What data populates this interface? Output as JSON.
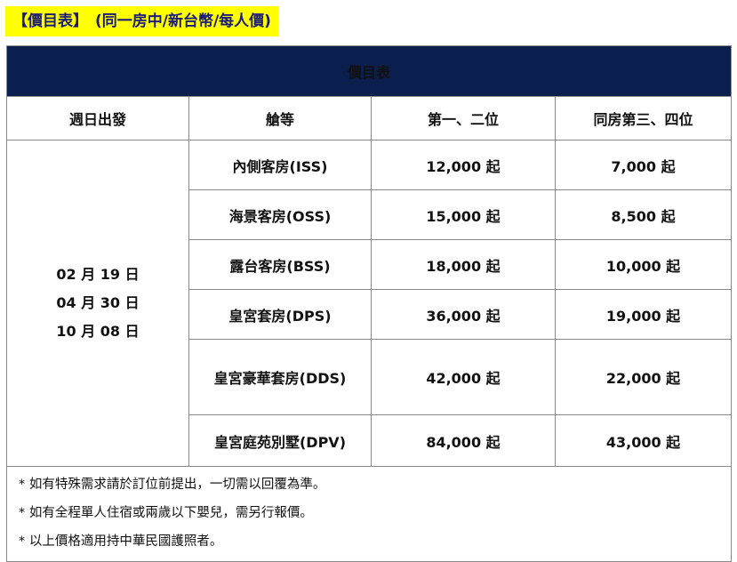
{
  "heading": {
    "title": "【價目表】",
    "subtitle": "(同一房中/新台幣/每人價)"
  },
  "table": {
    "title": "價目表",
    "columns": [
      "週日出發",
      "艙等",
      "第一、二位",
      "同房第三、四位"
    ],
    "departure_dates": [
      "02 月 19 日",
      "04 月 30 日",
      "10 月 08 日"
    ],
    "rows": [
      {
        "cabin": "內側客房(ISS)",
        "price_1_2": "12,000 起",
        "price_3_4": "7,000 起"
      },
      {
        "cabin": "海景客房(OSS)",
        "price_1_2": "15,000 起",
        "price_3_4": "8,500 起"
      },
      {
        "cabin": "露台客房(BSS)",
        "price_1_2": "18,000 起",
        "price_3_4": "10,000 起"
      },
      {
        "cabin": "皇宮套房(DPS)",
        "price_1_2": "36,000 起",
        "price_3_4": "19,000 起"
      },
      {
        "cabin": "皇宮豪華套房(DDS)",
        "price_1_2": "42,000 起",
        "price_3_4": "22,000 起"
      },
      {
        "cabin": "皇宮庭苑別墅(DPV)",
        "price_1_2": "84,000 起",
        "price_3_4": "43,000 起"
      }
    ],
    "notes": [
      "* 如有特殊需求請於訂位前提出，一切需以回覆為準。",
      "* 如有全程單人住宿或兩歲以下嬰兒，需另行報價。",
      "* 以上價格適用持中華民國護照者。"
    ]
  }
}
